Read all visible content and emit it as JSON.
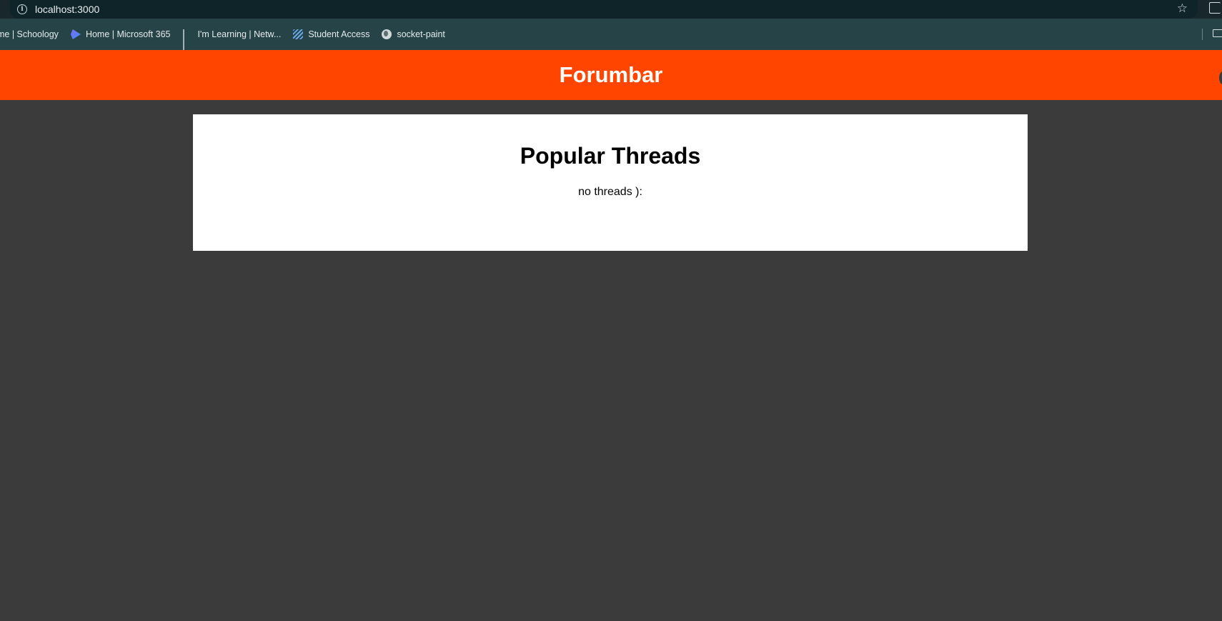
{
  "browser": {
    "url": "localhost:3000",
    "bookmarks": [
      {
        "label": "me | Schoology",
        "icon": "none"
      },
      {
        "label": "Home | Microsoft 365",
        "icon": "microsoft-365-icon"
      },
      {
        "label": "I'm Learning | Netw...",
        "icon": "cisco-icon"
      },
      {
        "label": "Student Access",
        "icon": "student-access-icon"
      },
      {
        "label": "socket-paint",
        "icon": "globe-icon"
      }
    ]
  },
  "header": {
    "title": "Forumbar",
    "color": "#ff4500"
  },
  "threads": {
    "heading": "Popular Threads",
    "empty_message": "no threads ):"
  }
}
